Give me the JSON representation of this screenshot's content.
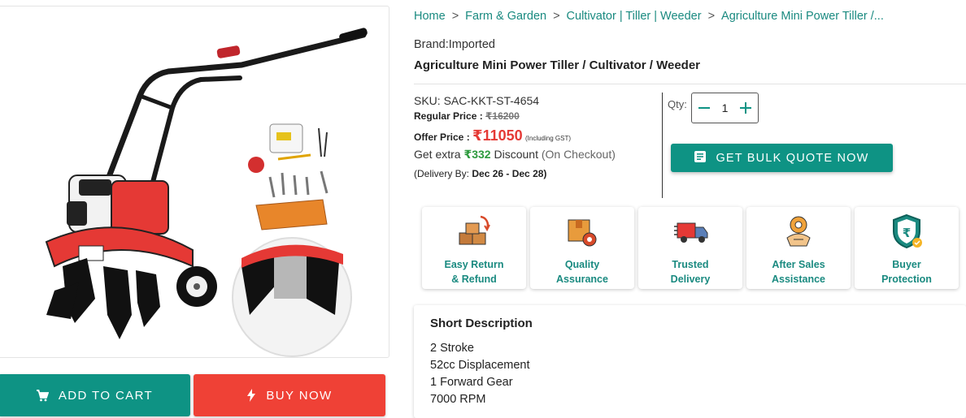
{
  "breadcrumb": {
    "items": [
      "Home",
      "Farm & Garden",
      "Cultivator | Tiller | Weeder",
      "Agriculture Mini Power Tiller /..."
    ],
    "separator": ">"
  },
  "product": {
    "brand": "Brand:Imported",
    "title": "Agriculture Mini Power Tiller / Cultivator / Weeder",
    "sku": "SKU: SAC-KKT-ST-4654",
    "regular_price_label": "Regular Price :",
    "regular_price": "₹16200",
    "offer_price_label": "Offer Price :",
    "offer_price": "₹11050",
    "gst_note": "(Including GST)",
    "extra_prefix": "Get extra",
    "extra_amount": "₹332",
    "extra_word": "Discount",
    "extra_note": "(On Checkout)",
    "delivery_label": "(Delivery By:",
    "delivery_dates": "Dec 26 - Dec 28)",
    "image_icon": "power-tiller-product-photo"
  },
  "quantity": {
    "label": "Qty:",
    "value": "1"
  },
  "actions": {
    "bulk_quote": "GET BULK QUOTE NOW",
    "add_to_cart": "ADD TO CART",
    "buy_now": "BUY NOW"
  },
  "features": [
    {
      "line1": "Easy Return",
      "line2": "& Refund",
      "icon": "return-boxes-icon"
    },
    {
      "line1": "Quality",
      "line2": "Assurance",
      "icon": "quality-box-icon"
    },
    {
      "line1": "Trusted",
      "line2": "Delivery",
      "icon": "delivery-truck-icon"
    },
    {
      "line1": "After Sales",
      "line2": "Assistance",
      "icon": "handshake-gear-icon"
    },
    {
      "line1": "Buyer",
      "line2": "Protection",
      "icon": "shield-rupee-icon"
    }
  ],
  "short_description": {
    "heading": "Short Description",
    "items": [
      "2 Stroke",
      "52cc Displacement",
      "1 Forward Gear",
      "7000 RPM"
    ]
  },
  "colors": {
    "accent": "#0e9384",
    "buy": "#ef4136",
    "price": "#e53935",
    "discount": "#2e9a3e"
  }
}
